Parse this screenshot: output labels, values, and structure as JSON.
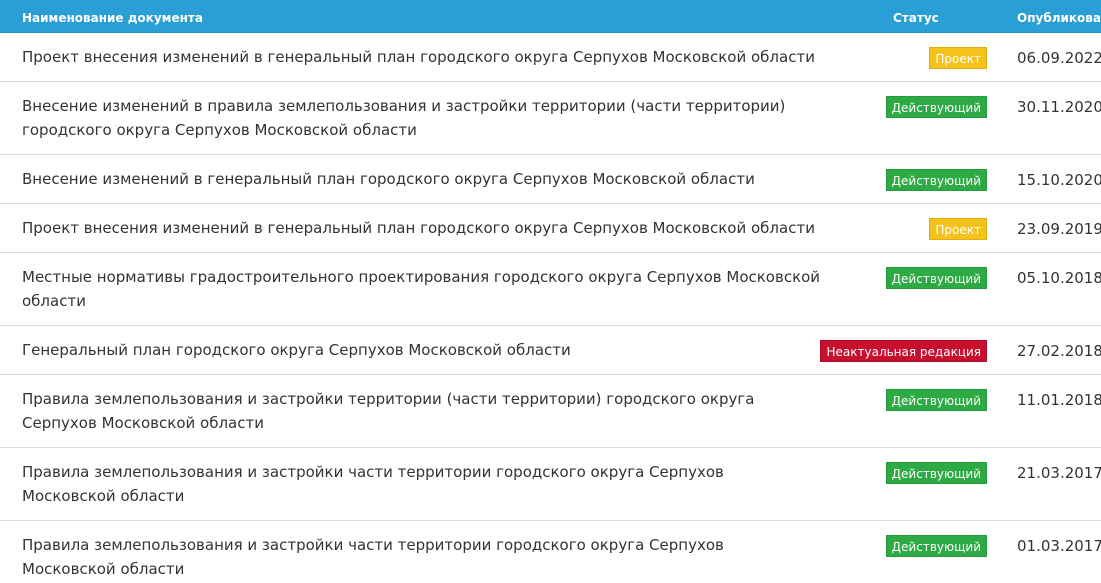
{
  "header": {
    "name_label": "Наименование документа",
    "status_label": "Статус",
    "date_label": "Опубликован"
  },
  "colors": {
    "header_bg": "#2a9fd6",
    "status_project": "#f5c21b",
    "status_active": "#2eaa45",
    "status_outdated": "#c8102e"
  },
  "rows": [
    {
      "name": "Проект внесения изменений в генеральный план городского округа Серпухов Московской области",
      "status": "Проект",
      "date": "06.09.2022"
    },
    {
      "name": "Внесение изменений в правила землепользования и застройки территории (части территории) городского округа Серпухов Московской области",
      "status": "Действующий",
      "date": "30.11.2020"
    },
    {
      "name": "Внесение изменений в генеральный план городского округа Серпухов Московской области",
      "status": "Действующий",
      "date": "15.10.2020"
    },
    {
      "name": "Проект внесения изменений в генеральный план городского округа Серпухов Московской области",
      "status": "Проект",
      "date": "23.09.2019"
    },
    {
      "name": "Местные нормативы градостроительного проектирования городского округа Серпухов Московской области",
      "status": "Действующий",
      "date": "05.10.2018"
    },
    {
      "name": "Генеральный план городского округа Серпухов Московской области",
      "status": "Неактуальная редакция",
      "date": "27.02.2018"
    },
    {
      "name": "Правила землепользования и застройки территории (части территории) городского округа Серпухов Московской области",
      "status": "Действующий",
      "date": "11.01.2018"
    },
    {
      "name": "Правила землепользования и застройки части территории городского округа Серпухов Московской области",
      "status": "Действующий",
      "date": "21.03.2017"
    },
    {
      "name": "Правила землепользования и застройки части территории городского округа Серпухов Московской области",
      "status": "Действующий",
      "date": "01.03.2017"
    }
  ]
}
